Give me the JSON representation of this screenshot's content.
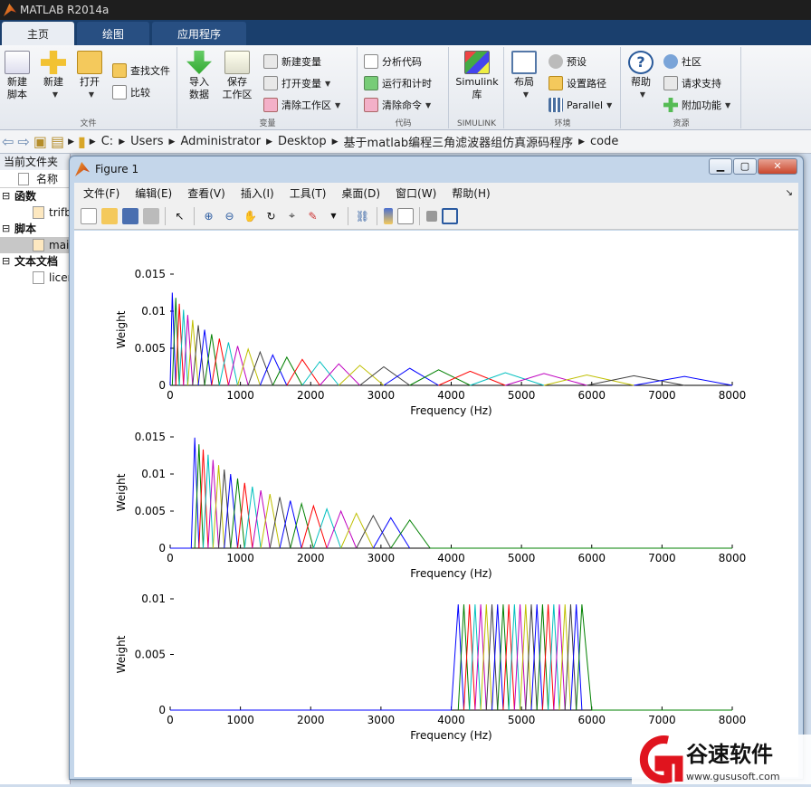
{
  "app": {
    "title": "MATLAB R2014a"
  },
  "ribbon_tabs": [
    {
      "label": "主页"
    },
    {
      "label": "绘图"
    },
    {
      "label": "应用程序"
    }
  ],
  "ribbon": {
    "file": {
      "group": "文件",
      "new_script": "新建\n脚本",
      "new": "新建",
      "open": "打开",
      "find_files": "查找文件",
      "compare": "比较"
    },
    "variable": {
      "group": "变量",
      "import": "导入\n数据",
      "save_ws": "保存\n工作区",
      "new_var": "新建变量",
      "open_var": "打开变量",
      "clear_ws": "清除工作区"
    },
    "code": {
      "group": "代码",
      "analyze": "分析代码",
      "run_time": "运行和计时",
      "clear_cmd": "清除命令"
    },
    "simulink": {
      "group": "SIMULINK",
      "lib": "Simulink\n库"
    },
    "env": {
      "group": "环境",
      "layout": "布局",
      "prefs": "预设",
      "set_path": "设置路径",
      "parallel": "Parallel"
    },
    "resources": {
      "group": "资源",
      "help": "帮助",
      "community": "社区",
      "support": "请求支持",
      "addons": "附加功能"
    }
  },
  "address": {
    "segments": [
      "C:",
      "Users",
      "Administrator",
      "Desktop",
      "基于matlab编程三角滤波器组仿真源码程序",
      "code"
    ]
  },
  "sidebar": {
    "title": "当前文件夹",
    "column": "名称",
    "sections": [
      {
        "label": "函数",
        "items": [
          "trifbank.m"
        ]
      },
      {
        "label": "脚本",
        "items": [
          "main.m"
        ]
      },
      {
        "label": "文本文档",
        "items": [
          "license.txt"
        ]
      }
    ]
  },
  "figure": {
    "title": "Figure 1",
    "menu": [
      "文件(F)",
      "编辑(E)",
      "查看(V)",
      "插入(I)",
      "工具(T)",
      "桌面(D)",
      "窗口(W)",
      "帮助(H)"
    ]
  },
  "colors": [
    "#0000ff",
    "#008000",
    "#ff0000",
    "#00bfbf",
    "#bf00bf",
    "#bfbf00",
    "#404040"
  ],
  "chart_data": [
    {
      "type": "line",
      "xlabel": "Frequency (Hz)",
      "ylabel": "Weight",
      "xlim": [
        0,
        8000
      ],
      "ylim": [
        0,
        0.015
      ],
      "xticks": [
        0,
        1000,
        2000,
        3000,
        4000,
        5000,
        6000,
        7000,
        8000
      ],
      "yticks": [
        0,
        0.005,
        0.01,
        0.015
      ],
      "ytick_labels": [
        "0",
        "0.005",
        "0.01",
        "0.015"
      ],
      "description": "Mel-scale triangular filterbank 0-8000 Hz",
      "centers": [
        30,
        80,
        130,
        190,
        250,
        320,
        400,
        490,
        590,
        700,
        830,
        960,
        1110,
        1280,
        1460,
        1660,
        1880,
        2130,
        2400,
        2700,
        3040,
        3410,
        3820,
        4270,
        4770,
        5320,
        5930,
        6600,
        7320
      ],
      "edges_start": 0,
      "edges_end": 8000,
      "peaks": [
        0.0125,
        0.0118,
        0.011,
        0.0102,
        0.0095,
        0.0088,
        0.0081,
        0.0075,
        0.0069,
        0.0063,
        0.0058,
        0.0053,
        0.0049,
        0.0045,
        0.0041,
        0.0038,
        0.0035,
        0.0032,
        0.0029,
        0.0027,
        0.0025,
        0.0023,
        0.0021,
        0.0019,
        0.0017,
        0.0016,
        0.0014,
        0.0013,
        0.0012
      ]
    },
    {
      "type": "line",
      "xlabel": "Frequency (Hz)",
      "ylabel": "Weight",
      "xlim": [
        0,
        8000
      ],
      "ylim": [
        0,
        0.015
      ],
      "xticks": [
        0,
        1000,
        2000,
        3000,
        4000,
        5000,
        6000,
        7000,
        8000
      ],
      "yticks": [
        0,
        0.005,
        0.01,
        0.015
      ],
      "ytick_labels": [
        "0",
        "0.005",
        "0.01",
        "0.015"
      ],
      "description": "Mel-scale triangular filterbank 300-3700 Hz",
      "centers": [
        350,
        410,
        470,
        540,
        610,
        690,
        770,
        860,
        960,
        1060,
        1170,
        1290,
        1420,
        1560,
        1710,
        1870,
        2040,
        2230,
        2430,
        2650,
        2890,
        3140,
        3410
      ],
      "edges_start": 300,
      "edges_end": 3700,
      "peaks": [
        0.0149,
        0.014,
        0.0133,
        0.0126,
        0.0119,
        0.0112,
        0.0106,
        0.01,
        0.0094,
        0.0088,
        0.0083,
        0.0078,
        0.0073,
        0.0069,
        0.0064,
        0.006,
        0.0057,
        0.0053,
        0.005,
        0.0047,
        0.0044,
        0.0041,
        0.0038
      ]
    },
    {
      "type": "line",
      "xlabel": "Frequency (Hz)",
      "ylabel": "Weight",
      "xlim": [
        0,
        8000
      ],
      "ylim": [
        0,
        0.01
      ],
      "xticks": [
        0,
        1000,
        2000,
        3000,
        4000,
        5000,
        6000,
        7000,
        8000
      ],
      "yticks": [
        0,
        0.005,
        0.01
      ],
      "ytick_labels": [
        "0",
        "0.005",
        "0.01"
      ],
      "description": "Linear triangular filterbank 4000-6000 Hz",
      "centers": [
        4100,
        4180,
        4260,
        4340,
        4420,
        4500,
        4580,
        4660,
        4740,
        4820,
        4900,
        4980,
        5060,
        5140,
        5220,
        5300,
        5380,
        5460,
        5540,
        5620,
        5700,
        5780,
        5860
      ],
      "edges_start": 4000,
      "edges_end": 6000,
      "peaks": [
        0.0095,
        0.0095,
        0.0095,
        0.0095,
        0.0095,
        0.0095,
        0.0095,
        0.0095,
        0.0095,
        0.0095,
        0.0095,
        0.0095,
        0.0095,
        0.0095,
        0.0095,
        0.0095,
        0.0095,
        0.0095,
        0.0095,
        0.0095,
        0.0095,
        0.0095,
        0.0095
      ]
    }
  ],
  "watermark": {
    "brand": "谷速软件",
    "url": "www.gususoft.com"
  }
}
